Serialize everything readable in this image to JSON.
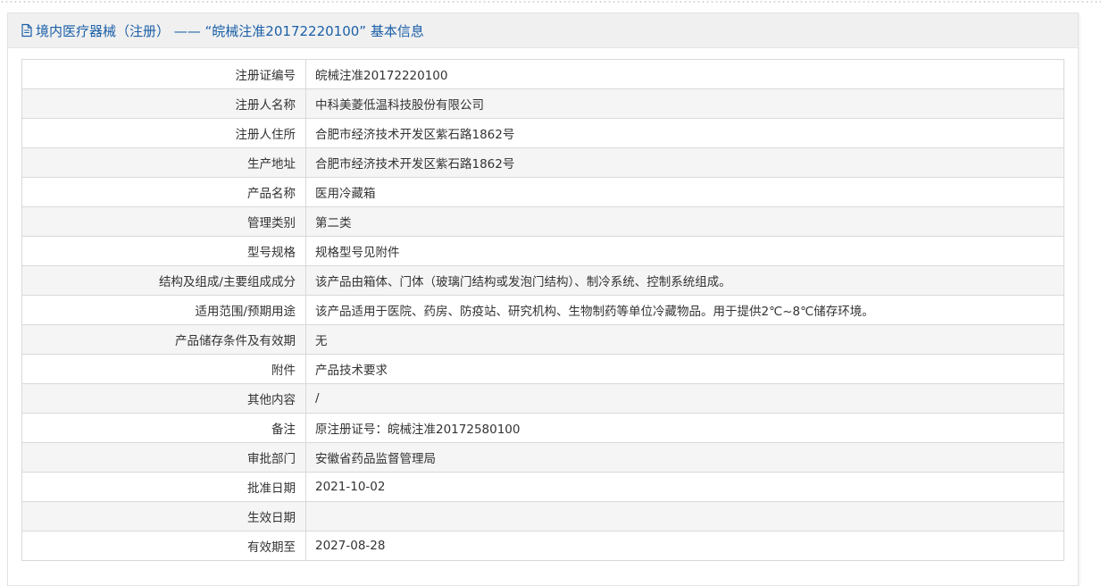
{
  "header": {
    "title": "境内医疗器械（注册） —— “皖械注准20172220100” 基本信息"
  },
  "rows": [
    {
      "label": "注册证编号",
      "value": "皖械注准20172220100"
    },
    {
      "label": "注册人名称",
      "value": "中科美菱低温科技股份有限公司"
    },
    {
      "label": "注册人住所",
      "value": "合肥市经济技术开发区紫石路1862号"
    },
    {
      "label": "生产地址",
      "value": "合肥市经济技术开发区紫石路1862号"
    },
    {
      "label": "产品名称",
      "value": "医用冷藏箱"
    },
    {
      "label": "管理类别",
      "value": "第二类"
    },
    {
      "label": "型号规格",
      "value": "规格型号见附件"
    },
    {
      "label": "结构及组成/主要组成成分",
      "value": "该产品由箱体、门体（玻璃门结构或发泡门结构）、制冷系统、控制系统组成。"
    },
    {
      "label": "适用范围/预期用途",
      "value": "该产品适用于医院、药房、防疫站、研究机构、生物制药等单位冷藏物品。用于提供2℃~8℃储存环境。"
    },
    {
      "label": "产品储存条件及有效期",
      "value": "无"
    },
    {
      "label": "附件",
      "value": "产品技术要求"
    },
    {
      "label": "其他内容",
      "value": "/"
    },
    {
      "label": "备注",
      "value": "原注册证号：皖械注准20172580100"
    },
    {
      "label": "审批部门",
      "value": "安徽省药品监督管理局"
    },
    {
      "label": "批准日期",
      "value": "2021-10-02"
    },
    {
      "label": "生效日期",
      "value": ""
    },
    {
      "label": "有效期至",
      "value": "2027-08-28"
    }
  ],
  "colors": {
    "header_text": "#1a5fa8",
    "header_bg": "#f0f0f0",
    "row_alt_bg": "#f5f5f5",
    "border": "#d9d9d9"
  }
}
